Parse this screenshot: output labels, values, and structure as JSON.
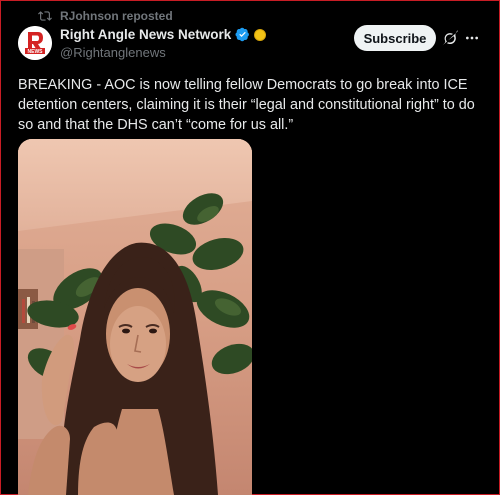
{
  "repost": {
    "text": "RJohnson reposted",
    "icon": "repost-icon"
  },
  "author": {
    "name": "Right Angle News Network",
    "handle": "@Rightanglenews",
    "avatar_text": "NEWS",
    "verified_color": "#1d9bf0",
    "badge_color": "#f3c316"
  },
  "actions": {
    "subscribe_label": "Subscribe"
  },
  "tweet": {
    "text": "BREAKING - AOC is now telling fellow Democrats to go break into ICE detention centers, claiming it is their “legal and constitutional right” to do so and that the DHS can’t “come for us all.”"
  },
  "media": {
    "type": "video-still"
  },
  "colors": {
    "background": "#000000",
    "text": "#e7e9ea",
    "secondary": "#71767b",
    "border": "#c81d25"
  }
}
